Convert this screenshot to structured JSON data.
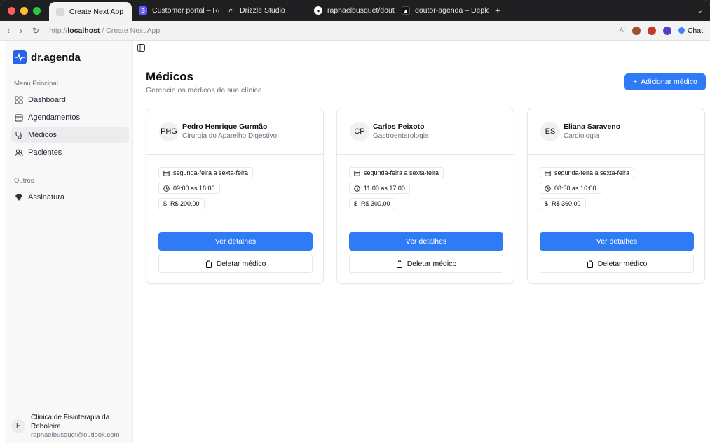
{
  "browser": {
    "tabs": [
      {
        "label": "Create Next App",
        "favicon": "page-icon",
        "active": true
      },
      {
        "label": "Customer portal – Rap",
        "favicon": "stripe-icon"
      },
      {
        "label": "Drizzle Studio",
        "favicon": "drizzle-icon"
      },
      {
        "label": "raphaelbusquet/doutor",
        "favicon": "github-icon"
      },
      {
        "label": "doutor-agenda – Deplo",
        "favicon": "vercel-icon"
      }
    ],
    "url_scheme": "http://",
    "url_host": "localhost",
    "url_suffix": " / Create Next App",
    "chat_label": "Chat"
  },
  "sidebar": {
    "brand": "dr.agenda",
    "menu_label": "Menu Principal",
    "items": [
      {
        "label": "Dashboard",
        "icon": "grid-icon"
      },
      {
        "label": "Agendamentos",
        "icon": "calendar-icon"
      },
      {
        "label": "Médicos",
        "icon": "stethoscope-icon",
        "active": true
      },
      {
        "label": "Pacientes",
        "icon": "users-icon"
      }
    ],
    "others_label": "Outros",
    "others_items": [
      {
        "label": "Assinatura",
        "icon": "gem-icon"
      }
    ],
    "user": {
      "initial": "F",
      "clinic": "Clinica de Fisioterapia da Reboleira",
      "email": "raphaelbusquet@outlook.com"
    }
  },
  "main": {
    "title": "Médicos",
    "subtitle": "Gerencie os médicos da sua clínica",
    "add_button": "Adicionar médico",
    "doctors": [
      {
        "initials": "PHG",
        "name": "Pedro Henrique Gurmão",
        "specialty": "Cirurgia do Aparelho Digestivo",
        "days": "segunda-feira a sexta-feira",
        "hours": "09:00 as 18:00",
        "price": "R$ 200,00"
      },
      {
        "initials": "CP",
        "name": "Carlos Peixoto",
        "specialty": "Gastroenterologia",
        "days": "segunda-feira a sexta-feira",
        "hours": "11:00 as 17:00",
        "price": "R$ 300,00"
      },
      {
        "initials": "ES",
        "name": "Eliana Saraveno",
        "specialty": "Cardiologia",
        "days": "segunda-feira a sexta-feira",
        "hours": "08:30 as 16:00",
        "price": "R$ 360,00"
      }
    ],
    "details_button": "Ver detalhes",
    "delete_button": "Deletar médico"
  },
  "colors": {
    "accent": "#2f7bf6",
    "brand": "#2563eb"
  }
}
